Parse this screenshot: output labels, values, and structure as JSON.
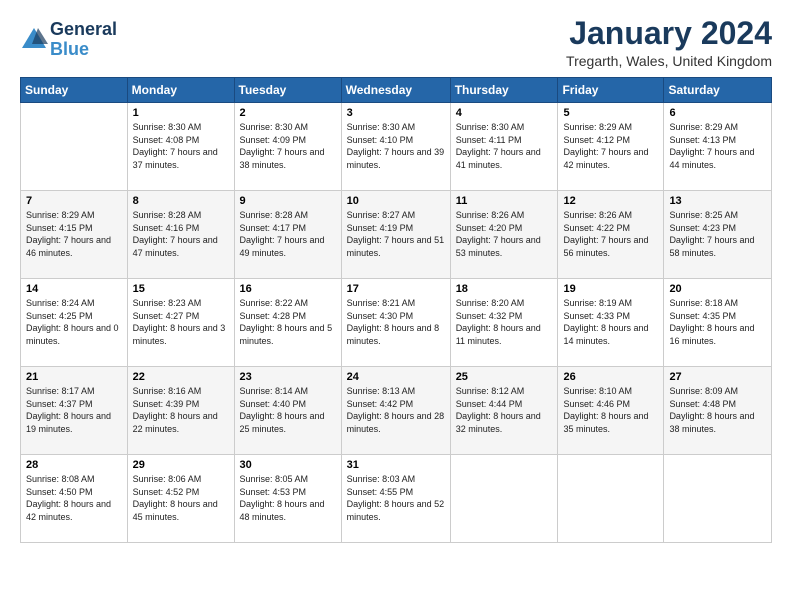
{
  "logo": {
    "line1": "General",
    "line2": "Blue"
  },
  "title": "January 2024",
  "location": "Tregarth, Wales, United Kingdom",
  "days_of_week": [
    "Sunday",
    "Monday",
    "Tuesday",
    "Wednesday",
    "Thursday",
    "Friday",
    "Saturday"
  ],
  "weeks": [
    [
      {
        "day": "",
        "sunrise": "",
        "sunset": "",
        "daylight": ""
      },
      {
        "day": "1",
        "sunrise": "Sunrise: 8:30 AM",
        "sunset": "Sunset: 4:08 PM",
        "daylight": "Daylight: 7 hours and 37 minutes."
      },
      {
        "day": "2",
        "sunrise": "Sunrise: 8:30 AM",
        "sunset": "Sunset: 4:09 PM",
        "daylight": "Daylight: 7 hours and 38 minutes."
      },
      {
        "day": "3",
        "sunrise": "Sunrise: 8:30 AM",
        "sunset": "Sunset: 4:10 PM",
        "daylight": "Daylight: 7 hours and 39 minutes."
      },
      {
        "day": "4",
        "sunrise": "Sunrise: 8:30 AM",
        "sunset": "Sunset: 4:11 PM",
        "daylight": "Daylight: 7 hours and 41 minutes."
      },
      {
        "day": "5",
        "sunrise": "Sunrise: 8:29 AM",
        "sunset": "Sunset: 4:12 PM",
        "daylight": "Daylight: 7 hours and 42 minutes."
      },
      {
        "day": "6",
        "sunrise": "Sunrise: 8:29 AM",
        "sunset": "Sunset: 4:13 PM",
        "daylight": "Daylight: 7 hours and 44 minutes."
      }
    ],
    [
      {
        "day": "7",
        "sunrise": "Sunrise: 8:29 AM",
        "sunset": "Sunset: 4:15 PM",
        "daylight": "Daylight: 7 hours and 46 minutes."
      },
      {
        "day": "8",
        "sunrise": "Sunrise: 8:28 AM",
        "sunset": "Sunset: 4:16 PM",
        "daylight": "Daylight: 7 hours and 47 minutes."
      },
      {
        "day": "9",
        "sunrise": "Sunrise: 8:28 AM",
        "sunset": "Sunset: 4:17 PM",
        "daylight": "Daylight: 7 hours and 49 minutes."
      },
      {
        "day": "10",
        "sunrise": "Sunrise: 8:27 AM",
        "sunset": "Sunset: 4:19 PM",
        "daylight": "Daylight: 7 hours and 51 minutes."
      },
      {
        "day": "11",
        "sunrise": "Sunrise: 8:26 AM",
        "sunset": "Sunset: 4:20 PM",
        "daylight": "Daylight: 7 hours and 53 minutes."
      },
      {
        "day": "12",
        "sunrise": "Sunrise: 8:26 AM",
        "sunset": "Sunset: 4:22 PM",
        "daylight": "Daylight: 7 hours and 56 minutes."
      },
      {
        "day": "13",
        "sunrise": "Sunrise: 8:25 AM",
        "sunset": "Sunset: 4:23 PM",
        "daylight": "Daylight: 7 hours and 58 minutes."
      }
    ],
    [
      {
        "day": "14",
        "sunrise": "Sunrise: 8:24 AM",
        "sunset": "Sunset: 4:25 PM",
        "daylight": "Daylight: 8 hours and 0 minutes."
      },
      {
        "day": "15",
        "sunrise": "Sunrise: 8:23 AM",
        "sunset": "Sunset: 4:27 PM",
        "daylight": "Daylight: 8 hours and 3 minutes."
      },
      {
        "day": "16",
        "sunrise": "Sunrise: 8:22 AM",
        "sunset": "Sunset: 4:28 PM",
        "daylight": "Daylight: 8 hours and 5 minutes."
      },
      {
        "day": "17",
        "sunrise": "Sunrise: 8:21 AM",
        "sunset": "Sunset: 4:30 PM",
        "daylight": "Daylight: 8 hours and 8 minutes."
      },
      {
        "day": "18",
        "sunrise": "Sunrise: 8:20 AM",
        "sunset": "Sunset: 4:32 PM",
        "daylight": "Daylight: 8 hours and 11 minutes."
      },
      {
        "day": "19",
        "sunrise": "Sunrise: 8:19 AM",
        "sunset": "Sunset: 4:33 PM",
        "daylight": "Daylight: 8 hours and 14 minutes."
      },
      {
        "day": "20",
        "sunrise": "Sunrise: 8:18 AM",
        "sunset": "Sunset: 4:35 PM",
        "daylight": "Daylight: 8 hours and 16 minutes."
      }
    ],
    [
      {
        "day": "21",
        "sunrise": "Sunrise: 8:17 AM",
        "sunset": "Sunset: 4:37 PM",
        "daylight": "Daylight: 8 hours and 19 minutes."
      },
      {
        "day": "22",
        "sunrise": "Sunrise: 8:16 AM",
        "sunset": "Sunset: 4:39 PM",
        "daylight": "Daylight: 8 hours and 22 minutes."
      },
      {
        "day": "23",
        "sunrise": "Sunrise: 8:14 AM",
        "sunset": "Sunset: 4:40 PM",
        "daylight": "Daylight: 8 hours and 25 minutes."
      },
      {
        "day": "24",
        "sunrise": "Sunrise: 8:13 AM",
        "sunset": "Sunset: 4:42 PM",
        "daylight": "Daylight: 8 hours and 28 minutes."
      },
      {
        "day": "25",
        "sunrise": "Sunrise: 8:12 AM",
        "sunset": "Sunset: 4:44 PM",
        "daylight": "Daylight: 8 hours and 32 minutes."
      },
      {
        "day": "26",
        "sunrise": "Sunrise: 8:10 AM",
        "sunset": "Sunset: 4:46 PM",
        "daylight": "Daylight: 8 hours and 35 minutes."
      },
      {
        "day": "27",
        "sunrise": "Sunrise: 8:09 AM",
        "sunset": "Sunset: 4:48 PM",
        "daylight": "Daylight: 8 hours and 38 minutes."
      }
    ],
    [
      {
        "day": "28",
        "sunrise": "Sunrise: 8:08 AM",
        "sunset": "Sunset: 4:50 PM",
        "daylight": "Daylight: 8 hours and 42 minutes."
      },
      {
        "day": "29",
        "sunrise": "Sunrise: 8:06 AM",
        "sunset": "Sunset: 4:52 PM",
        "daylight": "Daylight: 8 hours and 45 minutes."
      },
      {
        "day": "30",
        "sunrise": "Sunrise: 8:05 AM",
        "sunset": "Sunset: 4:53 PM",
        "daylight": "Daylight: 8 hours and 48 minutes."
      },
      {
        "day": "31",
        "sunrise": "Sunrise: 8:03 AM",
        "sunset": "Sunset: 4:55 PM",
        "daylight": "Daylight: 8 hours and 52 minutes."
      },
      {
        "day": "",
        "sunrise": "",
        "sunset": "",
        "daylight": ""
      },
      {
        "day": "",
        "sunrise": "",
        "sunset": "",
        "daylight": ""
      },
      {
        "day": "",
        "sunrise": "",
        "sunset": "",
        "daylight": ""
      }
    ]
  ]
}
